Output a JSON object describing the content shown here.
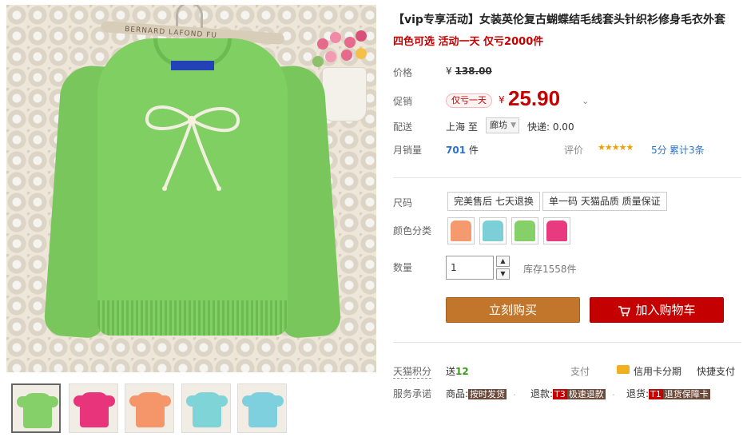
{
  "product": {
    "title": "【vip专享活动】女装英伦复古蝴蝶结毛线套头针织衫修身毛衣外套",
    "subtitle": "四色可选 活动一天 仅亏2000件",
    "hanger_text": "BERNARD LAFOND FU"
  },
  "price": {
    "label": "价格",
    "currency": "¥",
    "original": "138.00",
    "promo_label": "促销",
    "promo_badge": "仅亏一天",
    "current": "25.90",
    "chevron": "⌄"
  },
  "shipping": {
    "label": "配送",
    "from": "上海 至",
    "destination": "廊坊",
    "fee": "快递: 0.00"
  },
  "sales": {
    "label": "月销量",
    "count": "701",
    "unit": "件",
    "rating_label": "评价",
    "stars": "★★★★★",
    "score": "5分",
    "reviews": "累计3条"
  },
  "options": {
    "size_label": "尺码",
    "sizes": [
      "完美售后 七天退换",
      "单一码 天猫品质 质量保证"
    ],
    "color_label": "颜色分类",
    "colors": [
      "#f59a6e",
      "#7ccfd6",
      "#86d06a",
      "#e83a7e"
    ],
    "qty_label": "数量",
    "qty_value": "1",
    "stock": "库存1558件"
  },
  "actions": {
    "buy_now": "立刻购买",
    "add_cart": "加入购物车"
  },
  "extras": {
    "points_label": "天猫积分",
    "points_prefix": "送",
    "points": "12",
    "pay_label": "支付",
    "card_installment": "信用卡分期",
    "fast_pay": "快捷支付",
    "service_label": "服务承诺",
    "goods_label": "商品:",
    "goods_tag": "按时发货",
    "refund_label": "退款:",
    "refund_code": "T3",
    "refund_tag": "极速退款",
    "return_label": "退货:",
    "return_code": "T1",
    "return_tag": "退货保障卡"
  },
  "gallery": {
    "thumb_colors": [
      "#86d06a",
      "#e8347a",
      "#f5956a",
      "#7fd4d8",
      "#7fd0de"
    ]
  },
  "colors": {
    "accent_red": "#c40000",
    "buy_orange": "#c2762c",
    "link_blue": "#2a73c4"
  }
}
